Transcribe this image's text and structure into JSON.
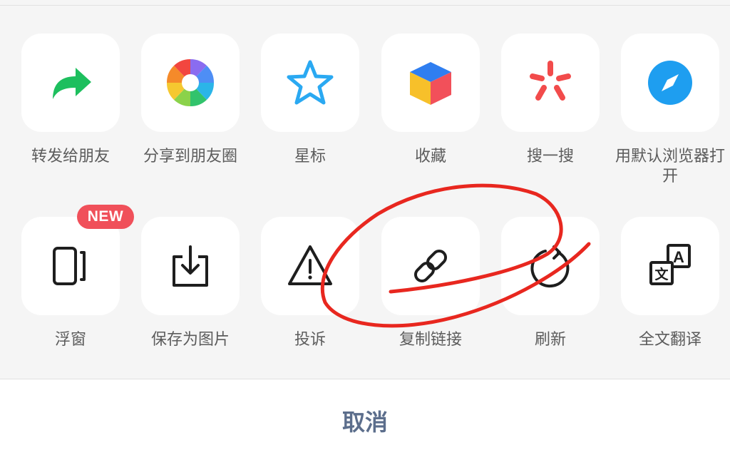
{
  "row1": [
    {
      "key": "forward",
      "label": "转发给朋友",
      "icon": "forward-arrow-icon"
    },
    {
      "key": "moments",
      "label": "分享到朋友圈",
      "icon": "moments-shutter-icon"
    },
    {
      "key": "star",
      "label": "星标",
      "icon": "star-icon"
    },
    {
      "key": "favorite",
      "label": "收藏",
      "icon": "favorite-cube-icon"
    },
    {
      "key": "search",
      "label": "搜一搜",
      "icon": "search-sparkle-icon"
    },
    {
      "key": "browser",
      "label": "用默认浏览器打开",
      "icon": "compass-icon"
    }
  ],
  "row2": [
    {
      "key": "float",
      "label": "浮窗",
      "icon": "float-window-icon"
    },
    {
      "key": "save_image",
      "label": "保存为图片",
      "icon": "save-download-icon"
    },
    {
      "key": "report",
      "label": "投诉",
      "icon": "warning-icon"
    },
    {
      "key": "copy_link",
      "label": "复制链接",
      "icon": "link-icon"
    },
    {
      "key": "refresh",
      "label": "刷新",
      "icon": "refresh-icon"
    },
    {
      "key": "translate",
      "label": "全文翻译",
      "icon": "translate-icon"
    }
  ],
  "badge": {
    "text": "NEW"
  },
  "cancel": {
    "label": "取消"
  },
  "colors": {
    "forward_green": "#1dbf5e",
    "star_blue": "#2aa9f2",
    "compass_blue": "#1e9ef0",
    "search_red": "#f24b4b",
    "badge_red": "#f0505a",
    "cancel_text": "#5c6e8c",
    "annotation_red": "#e8271f"
  },
  "translate_icon": {
    "letter_a": "A",
    "letter_wen": "文"
  }
}
